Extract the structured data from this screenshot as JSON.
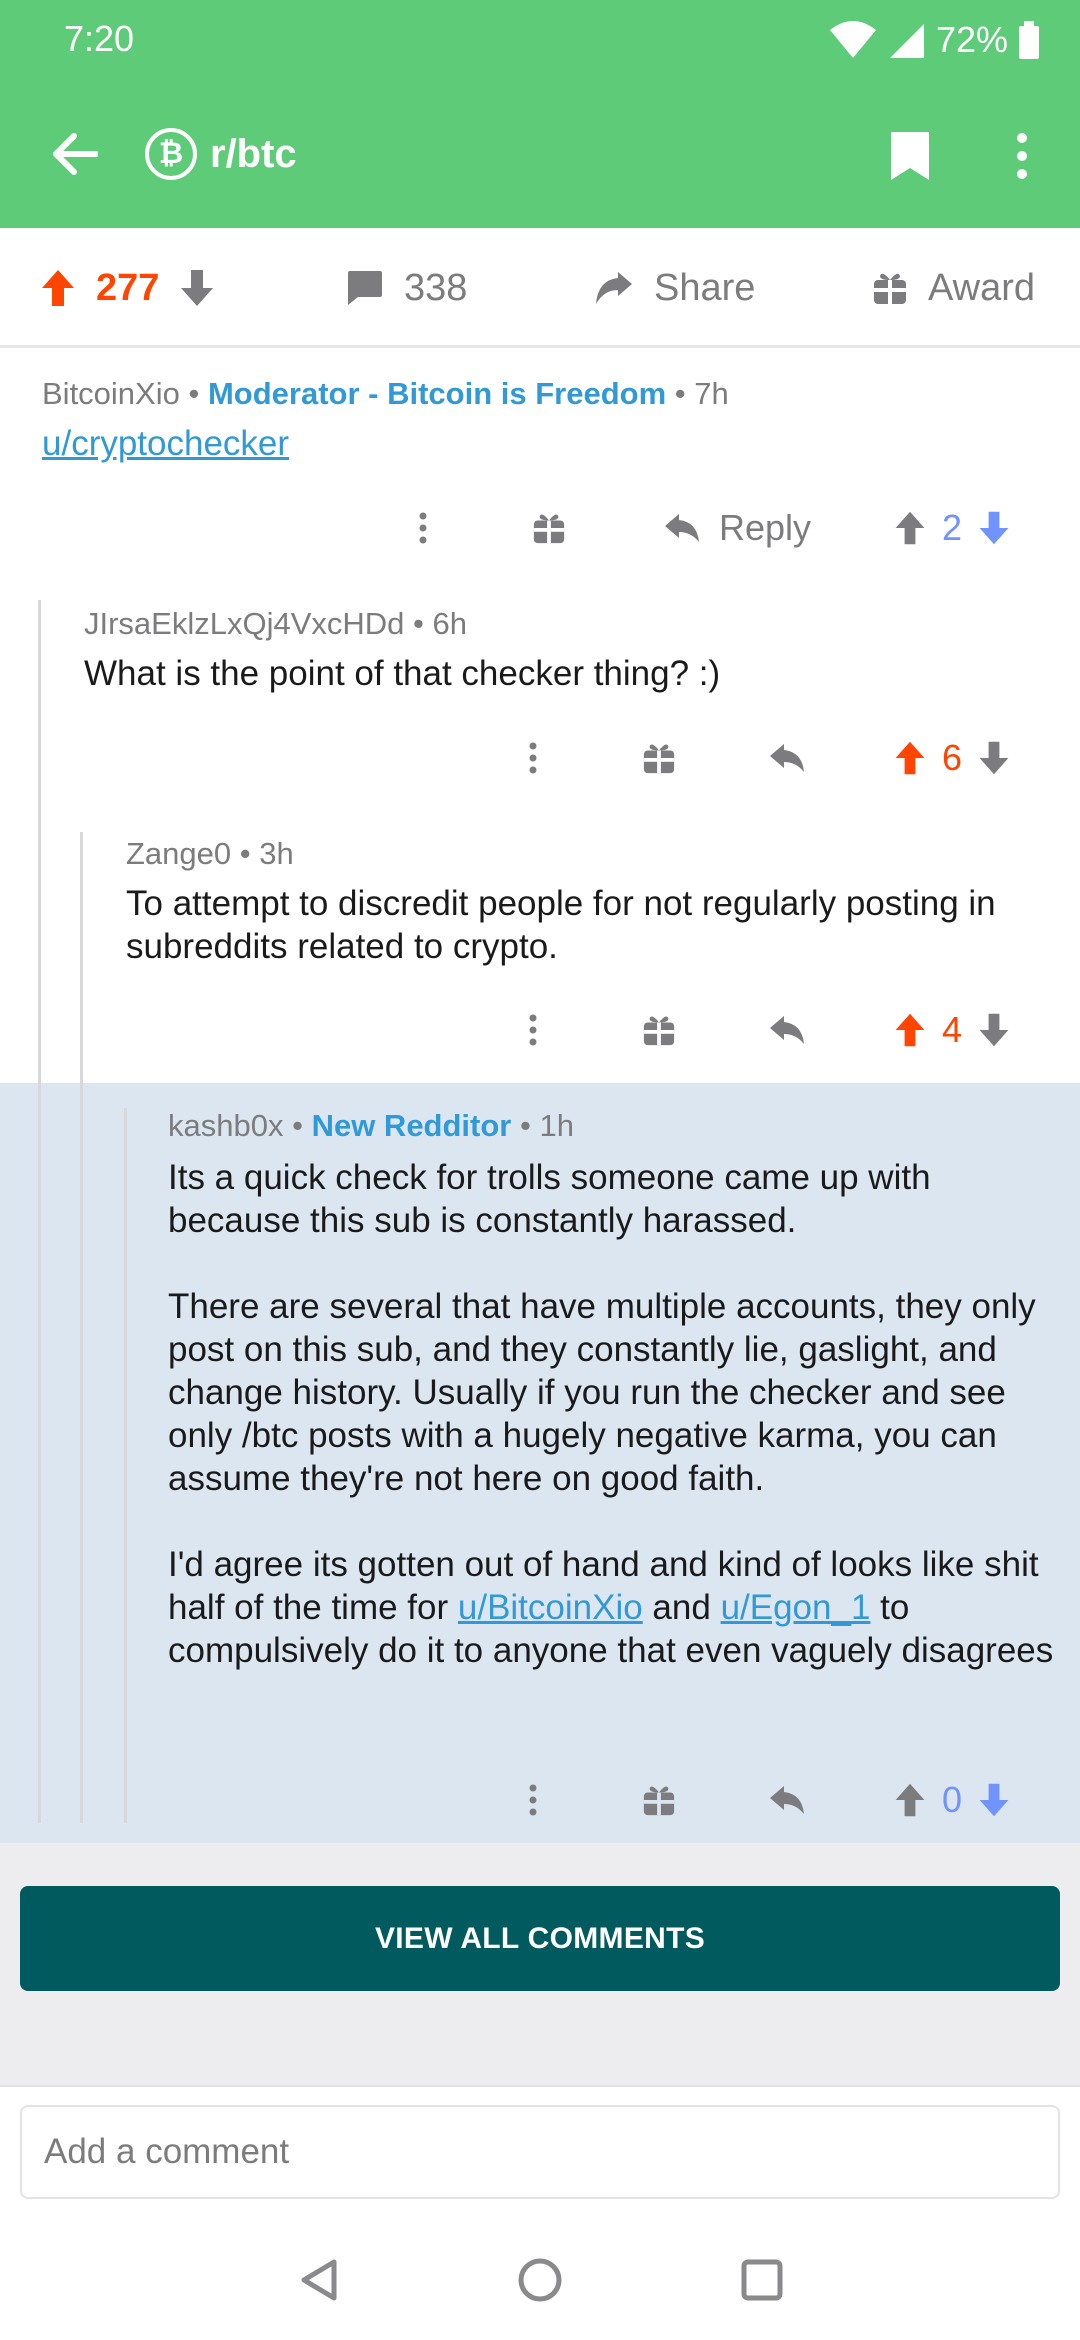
{
  "status_bar": {
    "time": "7:20",
    "battery": "72%"
  },
  "app_bar": {
    "subreddit": "r/btc",
    "sub_icon_glyph": "₿",
    "accent_color": "#5ecb78"
  },
  "post_actions": {
    "score": "277",
    "comments": "338",
    "share_label": "Share",
    "award_label": "Award"
  },
  "comments": [
    {
      "author": "BitcoinXio",
      "flair": "Moderator - Bitcoin is Freedom",
      "age": "7h",
      "body": [
        "u/cryptochecker"
      ],
      "reply_label": "Reply",
      "score": "2"
    },
    {
      "author": "JIrsaEklzLxQj4VxcHDd",
      "age": "6h",
      "body": [
        "What is the point of that checker thing? :)"
      ],
      "score": "6"
    },
    {
      "author": "Zange0",
      "age": "3h",
      "body": [
        "To attempt to discredit people for not regularly posting in subreddits related to crypto."
      ],
      "score": "4"
    },
    {
      "author": "kashb0x",
      "flair": "New Redditor",
      "age": "1h",
      "body": [
        "Its a quick check for trolls someone came up with because this sub is constantly harassed.",
        "There are several that have multiple accounts, they only post on this sub, and they constantly lie, gaslight, and change history. Usually if you run the checker and see only /btc posts with a hugely negative karma, you can assume they're not here on good faith."
      ],
      "para3": {
        "before": "I'd agree its gotten out of hand and kind of looks like shit half of the time for ",
        "link1": "u/BitcoinXio",
        "middle": " and ",
        "link2": "u/Egon_1",
        "after": " to compulsively do it to anyone that even vaguely disagrees"
      },
      "score": "0"
    }
  ],
  "separator": "•",
  "view_all_label": "VIEW ALL COMMENTS",
  "comment_input": {
    "placeholder": "Add a comment"
  },
  "colors": {
    "upvote": "#ff4500",
    "downvote": "#7193ff",
    "flair": "#3199d6",
    "button": "#005a5e",
    "highlight": "#dbe6f0"
  }
}
